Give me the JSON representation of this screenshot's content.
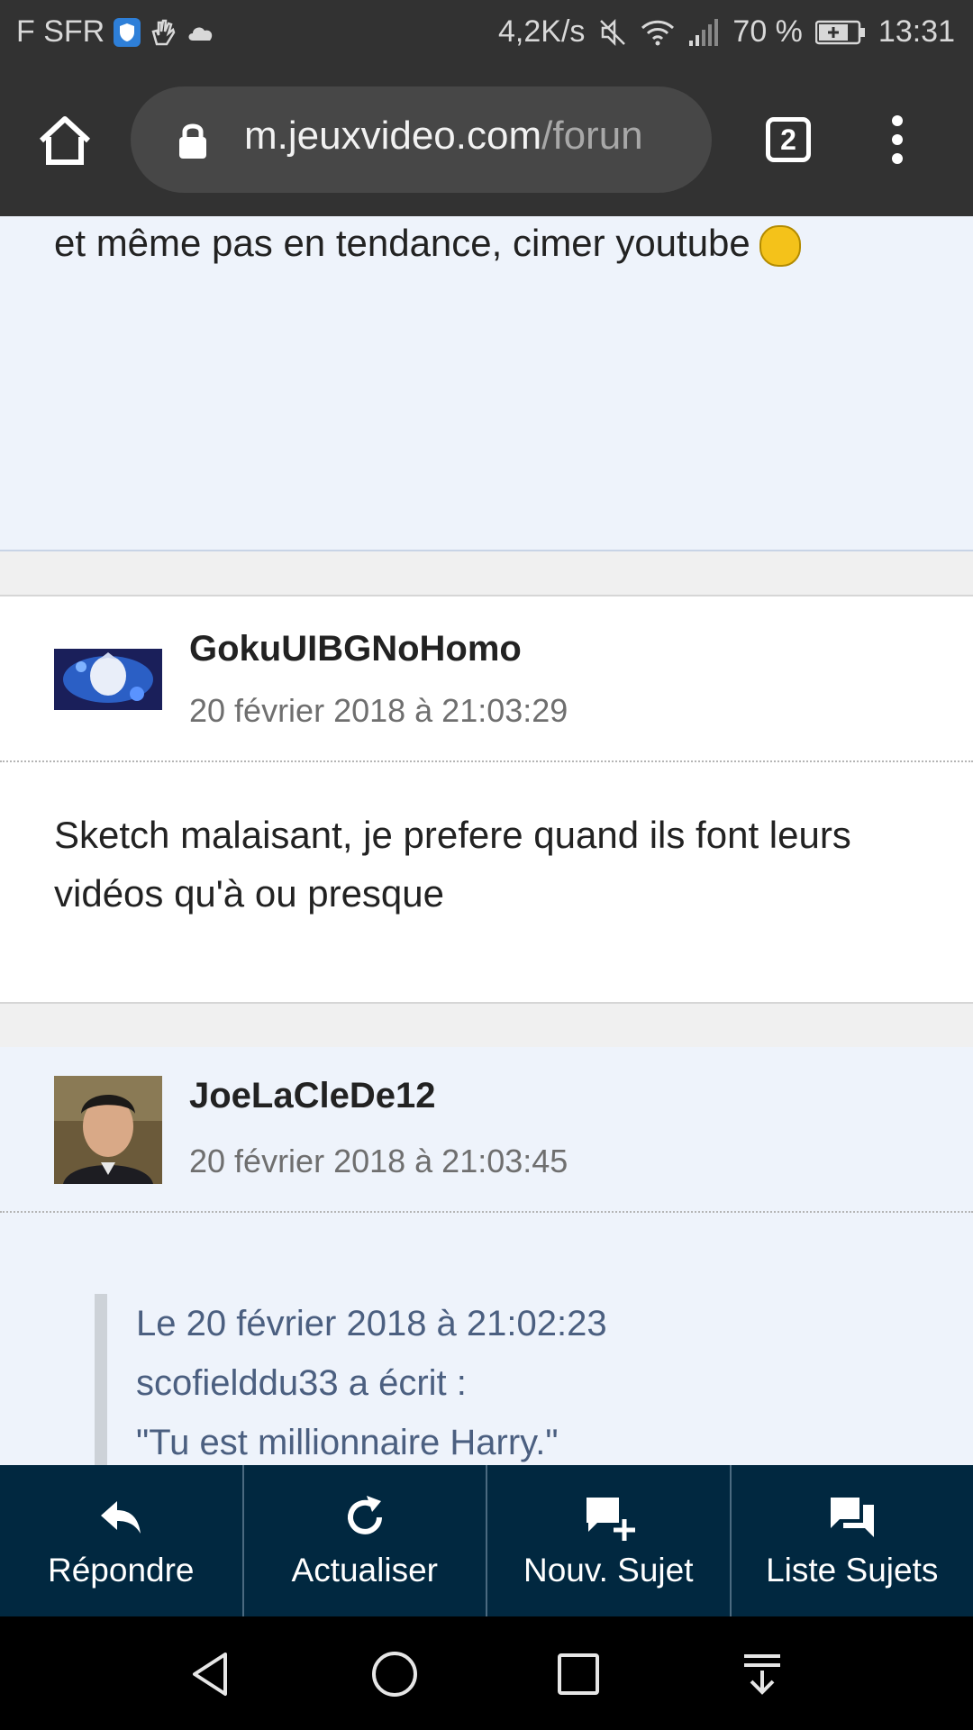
{
  "status_bar": {
    "carrier": "F SFR",
    "net_speed": "4,2K/s",
    "battery": "70 %",
    "time": "13:31"
  },
  "browser": {
    "url_domain": "m.jeuxvideo.com",
    "url_path": "/forun",
    "tab_count": "2"
  },
  "previous_post": {
    "text": "et même pas en tendance, cimer youtube"
  },
  "posts": [
    {
      "author": "GokuUIBGNoHomo",
      "date": "20 février 2018 à 21:03:29",
      "body": "Sketch malaisant, je prefere quand ils font leurs vidéos qu'à ou presque"
    },
    {
      "author": "JoeLaCleDe12",
      "date": "20 février 2018 à 21:03:45",
      "quote": {
        "line1": "Le 20 février 2018 à 21:02:23",
        "line2": "scofielddu33 a écrit :",
        "line3": "\"Tu est millionnaire Harry.\""
      }
    }
  ],
  "action_bar": {
    "reply": "Répondre",
    "refresh": "Actualiser",
    "new_topic": "Nouv. Sujet",
    "topic_list": "Liste Sujets"
  },
  "colors": {
    "status_bar": "#323232",
    "action_bar": "#012840",
    "post_blue": "#eef3fb",
    "quote_text": "#4b5f80"
  }
}
